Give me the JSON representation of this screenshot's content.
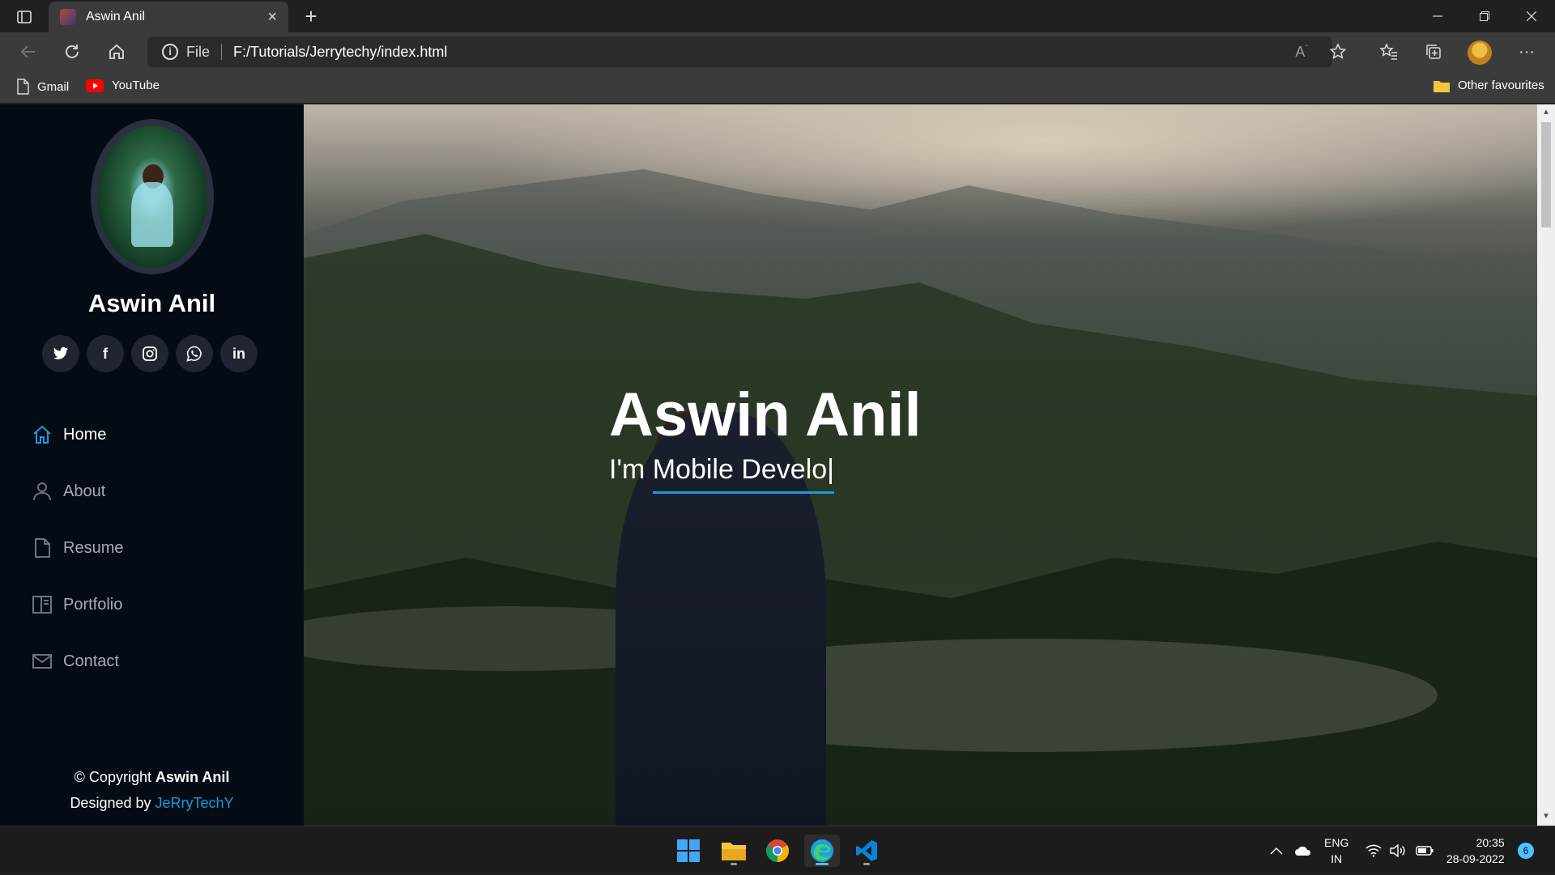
{
  "browser": {
    "tab_title": "Aswin Anil",
    "address_scheme": "File",
    "url": "F:/Tutorials/Jerrytechy/index.html",
    "bookmarks": [
      {
        "label": "Gmail",
        "icon": "page-icon"
      },
      {
        "label": "YouTube",
        "icon": "youtube-icon"
      }
    ],
    "other_favourites": "Other favourites"
  },
  "sidebar": {
    "name": "Aswin Anil",
    "socials": [
      {
        "name": "twitter",
        "glyph": "t"
      },
      {
        "name": "facebook",
        "glyph": "f"
      },
      {
        "name": "instagram",
        "glyph": "◎"
      },
      {
        "name": "whatsapp",
        "glyph": "✆"
      },
      {
        "name": "linkedin",
        "glyph": "in"
      }
    ],
    "nav": [
      {
        "label": "Home",
        "icon": "home-icon",
        "active": true
      },
      {
        "label": "About",
        "icon": "person-icon",
        "active": false
      },
      {
        "label": "Resume",
        "icon": "file-icon",
        "active": false
      },
      {
        "label": "Portfolio",
        "icon": "book-icon",
        "active": false
      },
      {
        "label": "Contact",
        "icon": "envelope-icon",
        "active": false
      }
    ],
    "footer": {
      "copyright_prefix": "© Copyright ",
      "copyright_name": "Aswin Anil",
      "designed_prefix": "Designed by ",
      "designer": "JeRryTechY"
    }
  },
  "hero": {
    "title": "Aswin Anil",
    "subtitle_prefix": "I'm ",
    "typed_text": "Mobile Develo",
    "cursor": "|"
  },
  "taskbar": {
    "lang_line1": "ENG",
    "lang_line2": "IN",
    "time": "20:35",
    "date": "28-09-2022",
    "notifications": "6"
  },
  "colors": {
    "accent": "#149ddd",
    "sidebar_bg": "#040b14",
    "social_bg": "#212431"
  }
}
